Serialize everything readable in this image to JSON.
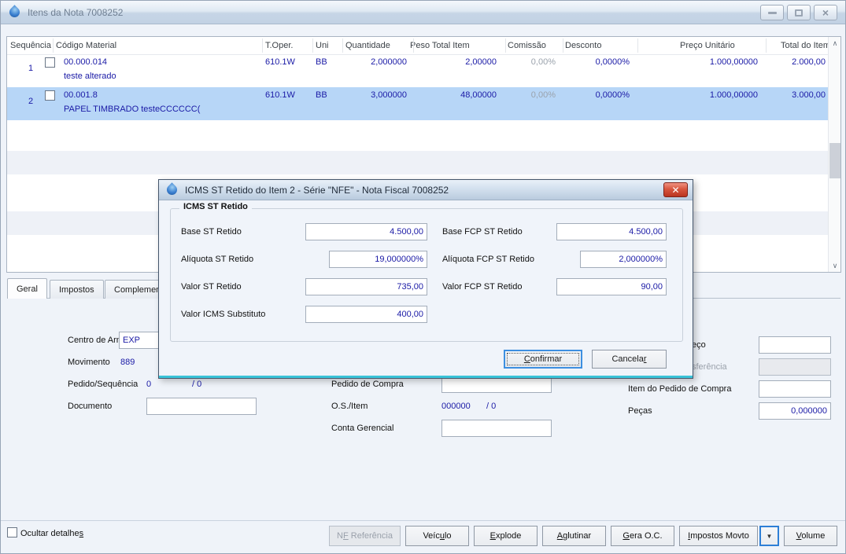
{
  "window": {
    "title": "Itens da Nota 7008252"
  },
  "table": {
    "headers": [
      "Sequência",
      "Código Material",
      "T.Oper.",
      "Uni",
      "Quantidade",
      "Peso Total Item",
      "Comissão",
      "Desconto",
      "Preço Unitário",
      "Total do Item"
    ],
    "rows": [
      {
        "seq": "1",
        "code": "00.000.014",
        "desc": "teste alterado",
        "toper": "610.1W",
        "uni": "BB",
        "qty": "2,000000",
        "peso": "2,00000",
        "comissao": "0,00%",
        "desconto": "0,0000%",
        "preco": "1.000,00000",
        "total": "2.000,00"
      },
      {
        "seq": "2",
        "code": "00.001.8",
        "desc": "PAPEL TIMBRADO testeCCCCCC(",
        "toper": "610.1W",
        "uni": "BB",
        "qty": "3,000000",
        "peso": "48,00000",
        "comissao": "0,00%",
        "desconto": "0,0000%",
        "preco": "1.000,00000",
        "total": "3.000,00"
      }
    ]
  },
  "tabs": [
    {
      "label": "Geral"
    },
    {
      "label": "Impostos"
    },
    {
      "label": "Complemen"
    }
  ],
  "form": {
    "left": [
      {
        "label": "Centro de Armazenagem",
        "value": "EXP"
      },
      {
        "label": "Movimento",
        "value": "889"
      },
      {
        "label": "Pedido/Sequência",
        "value": "0",
        "value2": "/ 0"
      },
      {
        "label": "Documento",
        "value": ""
      }
    ],
    "middle": [
      {
        "label": "Pedido de Compra",
        "value": ""
      },
      {
        "label": "O.S./Item",
        "value": "000000",
        "value2": "/ 0"
      },
      {
        "label": "Conta Gerencial",
        "value": ""
      }
    ],
    "right": [
      {
        "label": "eço",
        "value": ""
      },
      {
        "label": "sferência",
        "value": ""
      },
      {
        "label": "Item do Pedido de Compra",
        "value": ""
      },
      {
        "label": "Peças",
        "value": "0,000000"
      }
    ]
  },
  "dialog": {
    "title": "ICMS ST Retido do Item 2 - Série \"NFE\" - Nota Fiscal 7008252",
    "group_title": "ICMS ST Retido",
    "fields": [
      {
        "label": "Base ST Retido",
        "value": "4.500,00"
      },
      {
        "label": "Alíquota ST Retido",
        "value": "19,000000%"
      },
      {
        "label": "Valor ST Retido",
        "value": "735,00"
      },
      {
        "label": "Valor ICMS Substituto",
        "value": "400,00"
      },
      {
        "label": "Base FCP ST Retido",
        "value": "4.500,00"
      },
      {
        "label": "Alíquota FCP ST Retido",
        "value": "2,000000%"
      },
      {
        "label": "Valor FCP ST Retido",
        "value": "90,00"
      }
    ],
    "confirm": {
      "pre": "",
      "key": "C",
      "post": "onfirmar"
    },
    "cancel": {
      "pre": "Cancela",
      "key": "r",
      "post": ""
    }
  },
  "footer": {
    "hide_details": {
      "pre": "Ocultar detalhe",
      "key": "s",
      "post": ""
    },
    "buttons": [
      {
        "pre": "N",
        "key": "F",
        "post": " Referência"
      },
      {
        "pre": "Veíc",
        "key": "u",
        "post": "lo"
      },
      {
        "pre": "",
        "key": "E",
        "post": "xplode"
      },
      {
        "pre": "",
        "key": "A",
        "post": "glutinar"
      },
      {
        "pre": "",
        "key": "G",
        "post": "era O.C."
      },
      {
        "pre": "",
        "key": "I",
        "post": "mpostos Movto"
      },
      {
        "pre": "",
        "key": "V",
        "post": "olume"
      }
    ]
  },
  "colors": {
    "value_text": "#1a1aa6",
    "selected_row": "#b7d6f7",
    "dialog_accent": "#39c3d8",
    "close_button_red": "#c0392b",
    "focus_border": "#2e7fd6"
  }
}
